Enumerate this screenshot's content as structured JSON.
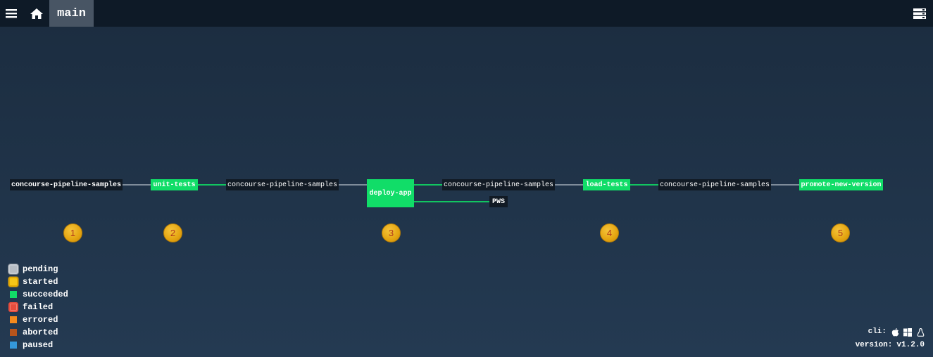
{
  "topbar": {
    "menu_icon": "hamburger-icon",
    "home_icon": "home-icon",
    "pipeline_name": "main",
    "groups_icon": "pipeline-groups-icon"
  },
  "graph": {
    "resources": [
      {
        "name": "concourse-pipeline-samples"
      },
      {
        "name": "concourse-pipeline-samples"
      },
      {
        "name": "concourse-pipeline-samples"
      },
      {
        "name": "concourse-pipeline-samples"
      },
      {
        "name": "PWS"
      }
    ],
    "jobs": [
      {
        "name": "unit-tests",
        "status": "succeeded"
      },
      {
        "name": "deploy-app",
        "status": "succeeded"
      },
      {
        "name": "load-tests",
        "status": "succeeded"
      },
      {
        "name": "promote-new-version",
        "status": "succeeded"
      }
    ],
    "badges": [
      "1",
      "2",
      "3",
      "4",
      "5"
    ]
  },
  "legend": [
    {
      "label": "pending",
      "color": "#b7bdc4",
      "border": "#aab0b8"
    },
    {
      "label": "started",
      "color": "#f5c518",
      "border": "#f0b400"
    },
    {
      "label": "succeeded",
      "color": "#11dd68"
    },
    {
      "label": "failed",
      "color": "#e74c3c",
      "border": "#e74c3c"
    },
    {
      "label": "errored",
      "color": "#f58a1d"
    },
    {
      "label": "aborted",
      "color": "#b7541b"
    },
    {
      "label": "paused",
      "color": "#3498db"
    }
  ],
  "info": {
    "cli_label": "cli:",
    "os_icons": [
      "apple-icon",
      "windows-icon",
      "linux-icon"
    ],
    "version_label": "version:",
    "version": "v1.2.0"
  },
  "colors": {
    "background": "#243a52",
    "topbar": "#0e1a27",
    "succeeded": "#11dd68",
    "resource": "#111a24",
    "edge": "#7f8c9a"
  }
}
